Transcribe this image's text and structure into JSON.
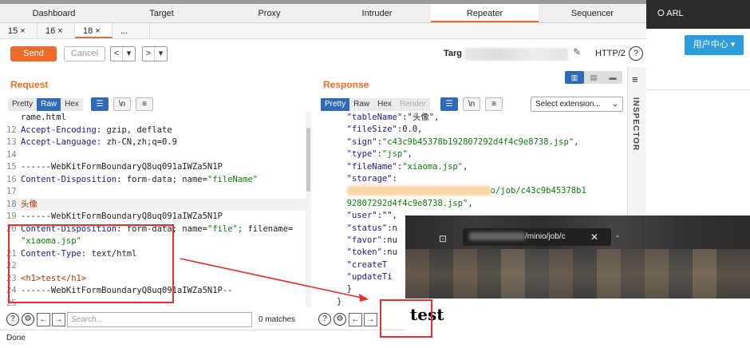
{
  "main_tabs": [
    "Dashboard",
    "Target",
    "Proxy",
    "Intruder",
    "Repeater",
    "Sequencer"
  ],
  "repeater_tabs": [
    "15 ×",
    "16 ×",
    "18 ×",
    "..."
  ],
  "toolbar": {
    "send": "Send",
    "cancel": "Cancel",
    "back": "<",
    "back_drop": "▾",
    "fwd": ">",
    "fwd_drop": "▾",
    "target_label": "Targ",
    "protocol": "HTTP/2",
    "help": "?"
  },
  "request": {
    "title": "Request",
    "view_modes": [
      "Pretty",
      "Raw",
      "Hex"
    ],
    "active_mode": "Raw",
    "newline_btn": "\\n",
    "lines": [
      {
        "n": "",
        "t": "rame.html"
      },
      {
        "n": "12",
        "k": "Accept-Encoding",
        "v": " gzip, deflate"
      },
      {
        "n": "13",
        "k": "Accept-Language",
        "v": " zh-CN,zh;q=0.9"
      },
      {
        "n": "14",
        "t": ""
      },
      {
        "n": "15",
        "t": "------WebKitFormBoundaryQ8uq091aIWZa5N1P"
      },
      {
        "n": "16",
        "k": "Content-Disposition",
        "v": " form-data; name=",
        "s": "\"fileName\""
      },
      {
        "n": "17",
        "t": ""
      },
      {
        "n": "18",
        "r": "头像"
      },
      {
        "n": "19",
        "t": "------WebKitFormBoundaryQ8uq091aIWZa5N1P"
      },
      {
        "n": "20",
        "k": "Content-Disposition",
        "v": " form-data; name=",
        "s": "\"file\"",
        "v2": "; filename="
      },
      {
        "n": "",
        "s": "\"xiaoma.jsp\""
      },
      {
        "n": "21",
        "k": "Content-Type",
        "v": " text/html"
      },
      {
        "n": "22",
        "t": ""
      },
      {
        "n": "23",
        "r": "<h1>test</h1>"
      },
      {
        "n": "24",
        "t": "------WebKitFormBoundaryQ8uq091aIWZa5N1P--"
      },
      {
        "n": "25",
        "t": ""
      }
    ],
    "search_placeholder": "Search...",
    "matches": "0 matches"
  },
  "response": {
    "title": "Response",
    "view_modes": [
      "Pretty",
      "Raw",
      "Hex",
      "Render"
    ],
    "active_mode": "Pretty",
    "newline_btn": "\\n",
    "select_extension": "Select extension...",
    "lines": [
      {
        "k": "\"tableName\"",
        "v": ":\"头像\","
      },
      {
        "k": "\"fileSize\"",
        "v": ":0.0,"
      },
      {
        "k": "\"sign\"",
        "v": ":",
        "s": "\"c43c9b45378b192807292d4f4c9e8738.jsp\"",
        "e": ","
      },
      {
        "k": "\"type\"",
        "v": ":",
        "s": "\"jsp\"",
        "e": ","
      },
      {
        "k": "\"fileName\"",
        "v": ":",
        "s": "\"xiaoma.jsp\"",
        "e": ","
      },
      {
        "k": "\"storage\"",
        "v": ":"
      },
      {
        "blur": true,
        "s": "o/job/c43c9b45378b1"
      },
      {
        "s": "92807292d4f4c9e8738.jsp\"",
        "e": ","
      },
      {
        "k": "\"user\"",
        "v": ":\"\","
      },
      {
        "k": "\"status\"",
        "v": ":n"
      },
      {
        "k": "\"favor\"",
        "v": ":nu"
      },
      {
        "k": "\"token\"",
        "v": ":nu"
      },
      {
        "k": "\"createT",
        "v": ""
      },
      {
        "k": "\"updateTi",
        "v": ""
      },
      {
        "t": "  }"
      },
      {
        "t": "}"
      }
    ]
  },
  "status": "Done",
  "inspector_label": "INSPECTOR",
  "right_app": {
    "arl": "ARL",
    "user_center": "用户中心 ▾"
  },
  "browser_popup": {
    "address_visible": "/minio/job/c",
    "page_text": "test"
  }
}
